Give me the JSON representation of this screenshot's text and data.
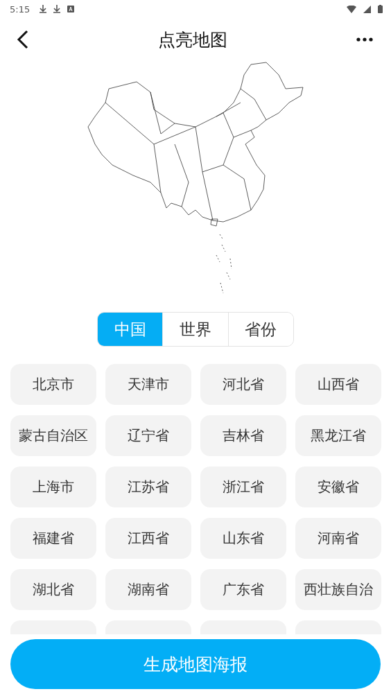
{
  "status_bar": {
    "time": "5:15"
  },
  "header": {
    "title": "点亮地图"
  },
  "tabs": [
    {
      "label": "中国",
      "selected": true
    },
    {
      "label": "世界",
      "selected": false
    },
    {
      "label": "省份",
      "selected": false
    }
  ],
  "provinces": [
    "北京市",
    "天津市",
    "河北省",
    "山西省",
    "蒙古自治区",
    "辽宁省",
    "吉林省",
    "黑龙江省",
    "上海市",
    "江苏省",
    "浙江省",
    "安徽省",
    "福建省",
    "江西省",
    "山东省",
    "河南省",
    "湖北省",
    "湖南省",
    "广东省",
    "西壮族自治"
  ],
  "action_button": {
    "label": "生成地图海报"
  }
}
